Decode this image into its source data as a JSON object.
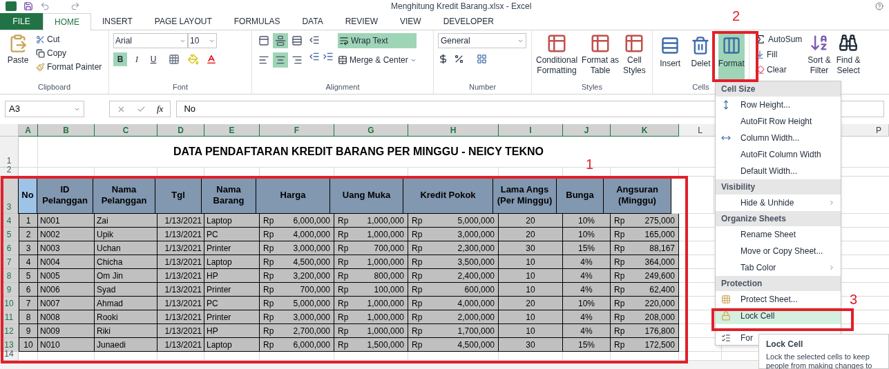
{
  "window": {
    "title": "Menghitung Kredit Barang.xlsx - Excel"
  },
  "tabs": [
    {
      "label": "FILE",
      "kind": "file",
      "selected": false
    },
    {
      "label": "HOME",
      "kind": "tab",
      "selected": true
    },
    {
      "label": "INSERT",
      "kind": "tab",
      "selected": false
    },
    {
      "label": "PAGE LAYOUT",
      "kind": "tab",
      "selected": false
    },
    {
      "label": "FORMULAS",
      "kind": "tab",
      "selected": false
    },
    {
      "label": "DATA",
      "kind": "tab",
      "selected": false
    },
    {
      "label": "REVIEW",
      "kind": "tab",
      "selected": false
    },
    {
      "label": "VIEW",
      "kind": "tab",
      "selected": false
    },
    {
      "label": "DEVELOPER",
      "kind": "tab",
      "selected": false
    }
  ],
  "ribbon": {
    "clipboard": {
      "label": "Clipboard",
      "paste": "Paste",
      "cut": "Cut",
      "copy": "Copy",
      "format_painter": "Format Painter"
    },
    "font": {
      "label": "Font",
      "font_name": "Arial",
      "font_size": "10",
      "bold": {
        "label": "B",
        "on": true
      },
      "italic": {
        "label": "I",
        "on": false
      },
      "underline": {
        "label": "U",
        "on": false
      }
    },
    "alignment": {
      "label": "Alignment",
      "vertical": [
        {
          "selected": false
        },
        {
          "selected": true
        },
        {
          "selected": false
        }
      ],
      "horizontal": [
        {
          "selected": false
        },
        {
          "selected": true
        },
        {
          "selected": false
        }
      ],
      "wrap_text": {
        "label": "Wrap Text",
        "on": true
      },
      "merge": "Merge & Center"
    },
    "number": {
      "label": "Number",
      "format": "General"
    },
    "styles": {
      "label": "Styles",
      "buttons": [
        {
          "line1": "Conditional",
          "line2": "Formatting"
        },
        {
          "line1": "Format as",
          "line2": "Table"
        },
        {
          "line1": "Cell",
          "line2": "Styles"
        }
      ]
    },
    "cells": {
      "label": "Cells",
      "buttons": [
        {
          "label": "Insert",
          "selected": false
        },
        {
          "label": "Delet",
          "selected": false
        },
        {
          "label": "Format",
          "selected": true
        }
      ]
    },
    "editing": {
      "autosum": "AutoSum",
      "fill": "Fill",
      "clear": "Clear",
      "sort": {
        "line1": "Sort &",
        "line2": "Filter"
      },
      "find": {
        "line1": "Find &",
        "line2": "Select"
      }
    }
  },
  "formula_bar": {
    "name_box": "A3",
    "function_label": "fx",
    "value": "No"
  },
  "sheet": {
    "columns": [
      {
        "label": "A",
        "selected": true
      },
      {
        "label": "B",
        "selected": true
      },
      {
        "label": "C",
        "selected": true
      },
      {
        "label": "D",
        "selected": true
      },
      {
        "label": "E",
        "selected": true
      },
      {
        "label": "F",
        "selected": true
      },
      {
        "label": "G",
        "selected": true
      },
      {
        "label": "H",
        "selected": true
      },
      {
        "label": "I",
        "selected": true
      },
      {
        "label": "J",
        "selected": true
      },
      {
        "label": "K",
        "selected": true
      },
      {
        "label": "L",
        "selected": false
      },
      {
        "label": "P",
        "selected": false
      }
    ],
    "row_numbers": [
      {
        "label": "1",
        "selected": false
      },
      {
        "label": "2",
        "selected": false
      },
      {
        "label": "3",
        "selected": true
      },
      {
        "label": "4",
        "selected": true
      },
      {
        "label": "5",
        "selected": true
      },
      {
        "label": "6",
        "selected": true
      },
      {
        "label": "7",
        "selected": true
      },
      {
        "label": "8",
        "selected": true
      },
      {
        "label": "9",
        "selected": true
      },
      {
        "label": "10",
        "selected": true
      },
      {
        "label": "11",
        "selected": true
      },
      {
        "label": "12",
        "selected": true
      },
      {
        "label": "13",
        "selected": true
      },
      {
        "label": "14",
        "selected": false
      }
    ],
    "title": "DATA PENDAFTARAN KREDIT BARANG PER MINGGU - NEICY TEKNO",
    "table": {
      "columns": [
        "No",
        "ID Pelanggan",
        "Nama Pelanggan",
        "Tgl",
        "Nama Barang",
        "Harga",
        "Uang Muka",
        "Kredit Pokok",
        "Lama Angs (Per Minggu)",
        "Bunga",
        "Angsuran (Minggu)"
      ],
      "rows": [
        [
          "1",
          "N001",
          "Zai",
          "1/13/2021",
          "Laptop",
          [
            "Rp",
            "6,000,000"
          ],
          [
            "Rp",
            "1,000,000"
          ],
          [
            "Rp",
            "5,000,000"
          ],
          "20",
          "10%",
          [
            "Rp",
            "275,000"
          ]
        ],
        [
          "2",
          "N002",
          "Upik",
          "1/13/2021",
          "PC",
          [
            "Rp",
            "4,000,000"
          ],
          [
            "Rp",
            "1,000,000"
          ],
          [
            "Rp",
            "3,000,000"
          ],
          "20",
          "10%",
          [
            "Rp",
            "165,000"
          ]
        ],
        [
          "3",
          "N003",
          "Uchan",
          "1/13/2021",
          "Printer",
          [
            "Rp",
            "3,000,000"
          ],
          [
            "Rp",
            "700,000"
          ],
          [
            "Rp",
            "2,300,000"
          ],
          "30",
          "15%",
          [
            "Rp",
            "88,167"
          ]
        ],
        [
          "4",
          "N004",
          "Chicha",
          "1/13/2021",
          "Laptop",
          [
            "Rp",
            "4,500,000"
          ],
          [
            "Rp",
            "1,000,000"
          ],
          [
            "Rp",
            "3,500,000"
          ],
          "10",
          "4%",
          [
            "Rp",
            "364,000"
          ]
        ],
        [
          "5",
          "N005",
          "Om Jin",
          "1/13/2021",
          "HP",
          [
            "Rp",
            "3,200,000"
          ],
          [
            "Rp",
            "800,000"
          ],
          [
            "Rp",
            "2,400,000"
          ],
          "10",
          "4%",
          [
            "Rp",
            "249,600"
          ]
        ],
        [
          "6",
          "N006",
          "Syad",
          "1/13/2021",
          "Printer",
          [
            "Rp",
            "700,000"
          ],
          [
            "Rp",
            "100,000"
          ],
          [
            "Rp",
            "600,000"
          ],
          "10",
          "4%",
          [
            "Rp",
            "62,400"
          ]
        ],
        [
          "7",
          "N007",
          "Ahmad",
          "1/13/2021",
          "PC",
          [
            "Rp",
            "5,000,000"
          ],
          [
            "Rp",
            "1,000,000"
          ],
          [
            "Rp",
            "4,000,000"
          ],
          "20",
          "10%",
          [
            "Rp",
            "220,000"
          ]
        ],
        [
          "8",
          "N008",
          "Rooki",
          "1/13/2021",
          "Printer",
          [
            "Rp",
            "3,000,000"
          ],
          [
            "Rp",
            "1,000,000"
          ],
          [
            "Rp",
            "2,000,000"
          ],
          "10",
          "4%",
          [
            "Rp",
            "208,000"
          ]
        ],
        [
          "9",
          "N009",
          "Riki",
          "1/13/2021",
          "HP",
          [
            "Rp",
            "2,700,000"
          ],
          [
            "Rp",
            "1,000,000"
          ],
          [
            "Rp",
            "1,700,000"
          ],
          "10",
          "4%",
          [
            "Rp",
            "176,800"
          ]
        ],
        [
          "10",
          "N010",
          "Junaedi",
          "1/13/2021",
          "Laptop",
          [
            "Rp",
            "6,000,000"
          ],
          [
            "Rp",
            "1,500,000"
          ],
          [
            "Rp",
            "4,500,000"
          ],
          "30",
          "15%",
          [
            "Rp",
            "172,500"
          ]
        ]
      ]
    }
  },
  "menu": {
    "sections": [
      {
        "header": "Cell Size",
        "items": [
          {
            "label": "Row Height...",
            "kind": "row-height",
            "submenu": false,
            "selected": false
          },
          {
            "label": "AutoFit Row Height",
            "submenu": false,
            "selected": false
          },
          {
            "label": "Column Width...",
            "kind": "column-width",
            "submenu": false,
            "selected": false
          },
          {
            "label": "AutoFit Column Width",
            "submenu": false,
            "selected": false
          },
          {
            "label": "Default Width...",
            "submenu": false,
            "selected": false
          }
        ]
      },
      {
        "header": "Visibility",
        "items": [
          {
            "label": "Hide & Unhide",
            "submenu": true,
            "selected": false
          }
        ]
      },
      {
        "header": "Organize Sheets",
        "items": [
          {
            "label": "Rename Sheet",
            "submenu": false,
            "selected": false
          },
          {
            "label": "Move or Copy Sheet...",
            "submenu": false,
            "selected": false
          },
          {
            "label": "Tab Color",
            "submenu": true,
            "selected": false
          }
        ]
      },
      {
        "header": "Protection",
        "items": [
          {
            "label": "Protect Sheet...",
            "kind": "protect",
            "submenu": false,
            "selected": false
          },
          {
            "label": "Lock Cell",
            "kind": "lock",
            "submenu": false,
            "selected": true
          },
          {
            "label": "For",
            "kind": "format",
            "selected": false
          }
        ]
      }
    ]
  },
  "tooltip": {
    "title": "Lock Cell",
    "text": "Lock the selected cells to keep people from making changes to"
  },
  "annotations": [
    {
      "label": "1"
    },
    {
      "label": "2"
    },
    {
      "label": "3"
    }
  ]
}
